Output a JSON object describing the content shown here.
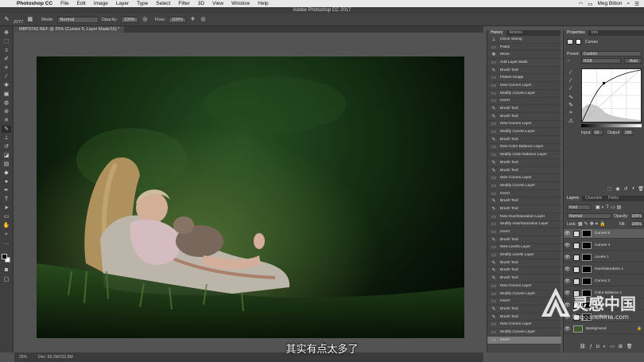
{
  "menubar": {
    "items": [
      "Photoshop CC",
      "File",
      "Edit",
      "Image",
      "Layer",
      "Type",
      "Select",
      "Filter",
      "3D",
      "View",
      "Window",
      "Help"
    ],
    "user": "Meg Bitton"
  },
  "window": {
    "title": "Adobe Photoshop CC 2017"
  },
  "options": {
    "brush_size": "2277",
    "mode_label": "Mode:",
    "mode_value": "Normal",
    "opacity_label": "Opacity:",
    "opacity_value": "100%",
    "flow_label": "Flow:",
    "flow_value": "100%"
  },
  "document": {
    "tab": "MBP3742.NEF @ 25% (Curves 5, Layer Mask/16) *"
  },
  "status": {
    "zoom": "25%",
    "doc": "Doc: 68.1M/232.8M"
  },
  "subtitle": "其实有点太多了",
  "history": {
    "tabs": [
      "History",
      "Actions"
    ],
    "items": [
      {
        "label": "Clone Stamp",
        "icon": "stamp-icon"
      },
      {
        "label": "Paste",
        "icon": "doc-icon"
      },
      {
        "label": "Move",
        "icon": "move-icon"
      },
      {
        "label": "Add Layer Mask",
        "icon": "doc-icon"
      },
      {
        "label": "Brush Tool",
        "icon": "brush-icon"
      },
      {
        "label": "Flatten Image",
        "icon": "doc-icon"
      },
      {
        "label": "New Curves Layer",
        "icon": "doc-icon"
      },
      {
        "label": "Modify Curves Layer",
        "icon": "doc-icon"
      },
      {
        "label": "Invert",
        "icon": "doc-icon"
      },
      {
        "label": "Brush Tool",
        "icon": "brush-icon"
      },
      {
        "label": "Brush Tool",
        "icon": "brush-icon"
      },
      {
        "label": "New Curves Layer",
        "icon": "doc-icon"
      },
      {
        "label": "Modify Curves Layer",
        "icon": "doc-icon"
      },
      {
        "label": "Brush Tool",
        "icon": "brush-icon"
      },
      {
        "label": "New Color Balance Layer",
        "icon": "doc-icon"
      },
      {
        "label": "Modify Color Balance Layer",
        "icon": "doc-icon"
      },
      {
        "label": "Brush Tool",
        "icon": "brush-icon"
      },
      {
        "label": "Brush Tool",
        "icon": "brush-icon"
      },
      {
        "label": "New Curves Layer",
        "icon": "doc-icon"
      },
      {
        "label": "Modify Curves Layer",
        "icon": "doc-icon"
      },
      {
        "label": "Invert",
        "icon": "doc-icon"
      },
      {
        "label": "Brush Tool",
        "icon": "brush-icon"
      },
      {
        "label": "Brush Tool",
        "icon": "brush-icon"
      },
      {
        "label": "New Hue/Saturation Layer",
        "icon": "doc-icon"
      },
      {
        "label": "Modify Hue/Saturation Layer",
        "icon": "doc-icon"
      },
      {
        "label": "Invert",
        "icon": "doc-icon"
      },
      {
        "label": "Brush Tool",
        "icon": "brush-icon"
      },
      {
        "label": "New Levels Layer",
        "icon": "doc-icon"
      },
      {
        "label": "Modify Levels Layer",
        "icon": "doc-icon"
      },
      {
        "label": "Brush Tool",
        "icon": "brush-icon"
      },
      {
        "label": "Brush Tool",
        "icon": "brush-icon"
      },
      {
        "label": "Brush Tool",
        "icon": "brush-icon"
      },
      {
        "label": "New Curves Layer",
        "icon": "doc-icon"
      },
      {
        "label": "Modify Curves Layer",
        "icon": "doc-icon"
      },
      {
        "label": "Invert",
        "icon": "doc-icon"
      },
      {
        "label": "Brush Tool",
        "icon": "brush-icon"
      },
      {
        "label": "Brush Tool",
        "icon": "brush-icon"
      },
      {
        "label": "New Curves Layer",
        "icon": "doc-icon"
      },
      {
        "label": "Modify Curves Layer",
        "icon": "doc-icon"
      },
      {
        "label": "Invert",
        "icon": "doc-icon",
        "current": true
      }
    ]
  },
  "properties": {
    "tabs": [
      "Properties",
      "Info"
    ],
    "title": "Curves",
    "preset_label": "Preset:",
    "preset_value": "Custom",
    "channel_value": "RGB",
    "auto_label": "Auto",
    "input_label": "Input:",
    "input_value": "62",
    "output_label": "Output:",
    "output_value": "180"
  },
  "layers_panel": {
    "tabs": [
      "Layers",
      "Channels",
      "Paths"
    ],
    "kind_value": "Kind",
    "blend_value": "Normal",
    "opacity_label": "Opacity:",
    "opacity_value": "100%",
    "lock_label": "Lock:",
    "fill_label": "Fill:",
    "fill_value": "100%",
    "layers": [
      {
        "name": "Curves 5",
        "type": "curves",
        "current": true
      },
      {
        "name": "Curves 4",
        "type": "curves"
      },
      {
        "name": "Levels 1",
        "type": "levels"
      },
      {
        "name": "Hue/Saturation 1",
        "type": "hue"
      },
      {
        "name": "Curves 3",
        "type": "curves"
      },
      {
        "name": "Color Balance 1",
        "type": "balance"
      },
      {
        "name": "Curves 2",
        "type": "curves"
      },
      {
        "name": "Curves 1",
        "type": "curves"
      },
      {
        "name": "Background",
        "type": "background"
      }
    ]
  },
  "watermark": {
    "brand": "灵感中国",
    "url": "lingganchina.com"
  },
  "colors": {
    "accent": "#1473e6",
    "panel": "#474747",
    "canvas_bg": "#535353"
  }
}
